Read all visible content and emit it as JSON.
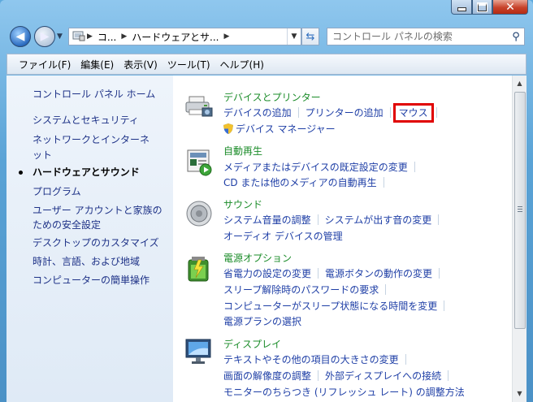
{
  "window": {
    "caption": {
      "minimize": "minimize",
      "maximize": "maximize",
      "close": "✕"
    }
  },
  "nav": {
    "address": {
      "crumbs": [
        "コ...",
        "ハードウェアとサ..."
      ]
    },
    "search_placeholder": "コントロール パネルの検索"
  },
  "menu": [
    "ファイル(F)",
    "編集(E)",
    "表示(V)",
    "ツール(T)",
    "ヘルプ(H)"
  ],
  "sidebar": {
    "home": "コントロール パネル ホーム",
    "items": [
      "システムとセキュリティ",
      "ネットワークとインターネ",
      "ット",
      "ハードウェアとサウンド",
      "プログラム",
      "ユーザー アカウントと家族の",
      "ための安全設定",
      "デスクトップのカスタマイズ",
      "時計、言語、および地域",
      "コンピューターの簡単操作"
    ],
    "active_index": 3
  },
  "categories": {
    "devices": {
      "title": "デバイスとプリンター",
      "links": [
        "デバイスの追加",
        "プリンターの追加",
        "マウス"
      ],
      "extra": "デバイス マネージャー"
    },
    "autoplay": {
      "title": "自動再生",
      "links": [
        "メディアまたはデバイスの既定設定の変更",
        "CD または他のメディアの自動再生"
      ]
    },
    "sound": {
      "title": "サウンド",
      "links": [
        "システム音量の調整",
        "システムが出す音の変更",
        "オーディオ デバイスの管理"
      ]
    },
    "power": {
      "title": "電源オプション",
      "links": [
        "省電力の設定の変更",
        "電源ボタンの動作の変更",
        "スリープ解除時のパスワードの要求",
        "コンピューターがスリープ状態になる時間を変更",
        "電源プランの選択"
      ]
    },
    "display": {
      "title": "ディスプレイ",
      "links": [
        "テキストやその他の項目の大きさの変更",
        "画面の解像度の調整",
        "外部ディスプレイへの接続",
        "モニターのちらつき (リフレッシュ レート) の調整方法"
      ]
    }
  },
  "highlight_color": "#e00000",
  "link_color": "#1f3fa6",
  "category_color": "#1b8c29"
}
